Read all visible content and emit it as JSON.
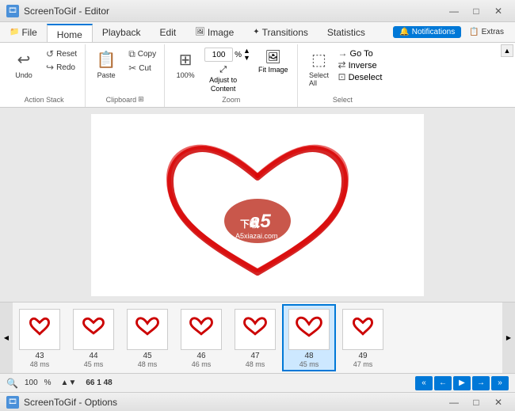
{
  "titleBar": {
    "title": "ScreenToGif - Editor",
    "icon": "🎞",
    "minimizeLabel": "—",
    "maximizeLabel": "□",
    "closeLabel": "✕"
  },
  "menuBar": {
    "tabs": [
      {
        "id": "file",
        "label": "File",
        "icon": "📁",
        "active": false
      },
      {
        "id": "home",
        "label": "Home",
        "icon": "",
        "active": true
      },
      {
        "id": "playback",
        "label": "Playback",
        "icon": "",
        "active": false
      },
      {
        "id": "edit",
        "label": "Edit",
        "icon": "",
        "active": false
      },
      {
        "id": "image",
        "label": "Image",
        "icon": "🖼",
        "active": false
      },
      {
        "id": "transitions",
        "label": "Transitions",
        "icon": "✦",
        "active": false
      },
      {
        "id": "statistics",
        "label": "Statistics",
        "icon": "",
        "active": false
      }
    ],
    "notifications": "Notifications",
    "extras": "Extras"
  },
  "ribbon": {
    "groups": {
      "actionStack": {
        "label": "Action Stack",
        "undo": "Undo",
        "reset": "Reset",
        "redo": "Redo"
      },
      "clipboard": {
        "label": "Clipboard",
        "paste": "Paste",
        "copy": "Copy",
        "cut": "Cut",
        "expandIcon": "⊞"
      },
      "zoom": {
        "label": "Zoom",
        "btn100": "100%",
        "adjustLabel": "Adjust to\nContent",
        "fitImage": "Fit Image",
        "currentZoom": "100",
        "percent": "%"
      },
      "select": {
        "label": "Select",
        "selectAll": "Select\nAll",
        "goTo": "Go To",
        "inverse": "Inverse",
        "deselect": "Deselect"
      }
    }
  },
  "frames": [
    {
      "number": "43",
      "time": "48 ms",
      "active": false
    },
    {
      "number": "44",
      "time": "45 ms",
      "active": false
    },
    {
      "number": "45",
      "time": "48 ms",
      "active": false
    },
    {
      "number": "46",
      "time": "46 ms",
      "active": false
    },
    {
      "number": "47",
      "time": "48 ms",
      "active": false
    },
    {
      "number": "48",
      "time": "45 ms",
      "active": true
    },
    {
      "number": "49",
      "time": "47 ms",
      "active": false
    }
  ],
  "statusBar": {
    "zoomIcon": "🔍",
    "zoomValue": "100",
    "percent": "%",
    "coords": "66 1 48",
    "navFirst": "«",
    "navPrev": "←",
    "navPlay": "▶",
    "navNext": "→",
    "navLast": "»"
  },
  "bottomTitleBar": {
    "title": "ScreenToGif - Options",
    "icon": "🎞",
    "minimizeLabel": "—",
    "maximizeLabel": "□",
    "closeLabel": "✕"
  }
}
